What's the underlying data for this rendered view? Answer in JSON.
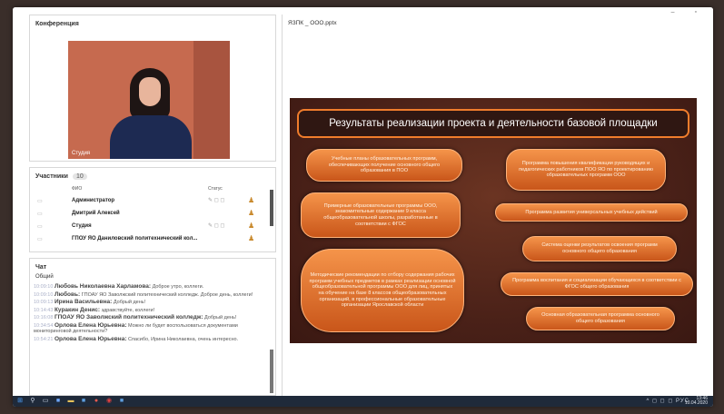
{
  "window": {
    "controls": "–  ▫"
  },
  "conference": {
    "title": "Конференция",
    "video_caption": "Студия"
  },
  "participants": {
    "title": "Участники",
    "count": "10",
    "col_name": "ФИО",
    "col_status": "Статус",
    "rows": [
      {
        "name": "Администратор",
        "status": "✎ ◻ ◻",
        "user_icon": "♟"
      },
      {
        "name": "Дмитрий Алексей",
        "status": "",
        "user_icon": "♟"
      },
      {
        "name": "Студия",
        "status": "✎ ◻ ◻",
        "user_icon": "♟"
      },
      {
        "name": "ГПОУ ЯО Даниловский политехнический кол...",
        "status": "",
        "user_icon": "♟"
      }
    ]
  },
  "chat": {
    "title": "Чат",
    "tab": "Общий",
    "messages": [
      {
        "time": "10:09:10",
        "name": "Любовь Николаевна Харламова:",
        "text": "Доброе утро, коллеги.",
        "big": true
      },
      {
        "time": "10:09:10",
        "name": "Любовь:",
        "text": "ГПОАУ ЯО Заволжский политехнический колледж. Доброе день, коллеги!",
        "big": true
      },
      {
        "time": "10:09:13",
        "name": "Ирина Васильевна:",
        "text": "Добрый день!",
        "big": true
      },
      {
        "time": "10:14:43",
        "name": "Куракин Денис:",
        "text": "здравствуйте, коллеги!",
        "big": true
      },
      {
        "time": "10:16:08",
        "name": "ГПОАУ ЯО Заволжский политехнический колледж:",
        "text": "Добрый день!",
        "big": true
      },
      {
        "time": "10:34:54",
        "name": "Орлова Елена Юрьевна:",
        "text": "Можно ли будет воспользоваться документами мониторинговой деятельности?",
        "big": true
      },
      {
        "time": "10:54:21",
        "name": "Орлова Елена Юрьевна:",
        "text": "Спасибо, Ирина Николаевна, очень интересно.",
        "big": true
      }
    ]
  },
  "presentation": {
    "file_name": "ЯЗПК _ ООО.pptx",
    "slide_title": "Результаты реализации проекта и деятельности базовой площадки",
    "left_items": [
      "Учебные планы образовательных программ, обеспечивающих получение основного общего образования в ПОО",
      "Примерные образовательные программы ООО, знакомительные содержание 9 класса общеобразовательной школы, разработанные в соответствии с ФГОС",
      "Методические рекомендации по отбору содержания рабочих программ учебных предметов в рамках реализации основной общеобразовательной программы ООО для лиц, принятых на обучение на базе 8 классов общеобразовательных организаций, в профессиональные образовательные организации Ярославской области"
    ],
    "right_items": [
      "Программа повышения квалификации руководящих и педагогических работников ПОО ЯО по проектированию образовательных программ ООО",
      "Программа развития универсальных учебных действий",
      "Система оценки результатов освоения программ основного общего образования",
      "Программа воспитания и социализации обучающихся в соответствии с ФГОС общего образования",
      "Основная образовательная программа основного общего образования"
    ],
    "accent_color": "#f07d2c"
  },
  "taskbar": {
    "icons": [
      "windows-icon",
      "search-icon",
      "task-view-icon",
      "store-icon",
      "explorer-icon",
      "mail-icon",
      "chrome-icon",
      "app-icon",
      "browser-icon"
    ],
    "time": "13:46",
    "date": "10.04.2020",
    "tray": "^ ◻ ◻ ◻ РУС"
  }
}
